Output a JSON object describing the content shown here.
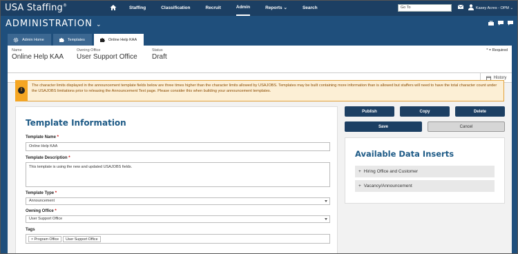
{
  "app": {
    "brand": "USA Staffing",
    "brand_mark": "®"
  },
  "nav": {
    "items": [
      "Staffing",
      "Classification",
      "Recruit",
      "Admin",
      "Reports",
      "Search"
    ],
    "active": "Admin",
    "goto_placeholder": "Go To",
    "user": "Kasey Acres - OPM"
  },
  "header": {
    "title": "ADMINISTRATION"
  },
  "tabs": [
    {
      "label": "Admin Home",
      "icon": "gear-icon"
    },
    {
      "label": "Templates",
      "icon": "puzzle-icon"
    },
    {
      "label": "Online Help KAA",
      "icon": "puzzle-icon"
    }
  ],
  "info": {
    "name_label": "Name",
    "name_value": "Online Help KAA",
    "office_label": "Owning Office",
    "office_value": "User Support Office",
    "status_label": "Status",
    "status_value": "Draft",
    "required_note": "* = Required",
    "history_label": "History"
  },
  "warning": {
    "text": "The character limits displayed in the announcement template fields below are three times higher than the character limits allowed by USAJOBS. Templates may be built containing more information than is allowed but staffers will need to have the total character count under the USAJOBS limitations prior to releasing the Announcement Text page. Please consider this when building your announcement templates."
  },
  "form": {
    "title": "Template Information",
    "template_name_label": "Template Name",
    "template_name_value": "Online Help KAA",
    "description_label": "Template Description",
    "description_value": "This template is using the new and updated USAJOBS fields.",
    "type_label": "Template Type",
    "type_value": "Announcement",
    "owning_office_label": "Owning Office",
    "owning_office_value": "User Support Office",
    "tags_label": "Tags",
    "tags": [
      "× Program Office",
      "User Support Office"
    ],
    "required_mark": "*"
  },
  "actions": {
    "publish": "Publish",
    "copy": "Copy",
    "delete": "Delete",
    "save": "Save",
    "cancel": "Cancel"
  },
  "inserts": {
    "title": "Available Data Inserts",
    "items": [
      "Hiring Office and Customer",
      "Vacancy/Announcement"
    ]
  },
  "colors": {
    "nav": "#1c3f63",
    "page": "#1f4f7c",
    "accent": "#1d5a86",
    "warning": "#f5a623"
  }
}
